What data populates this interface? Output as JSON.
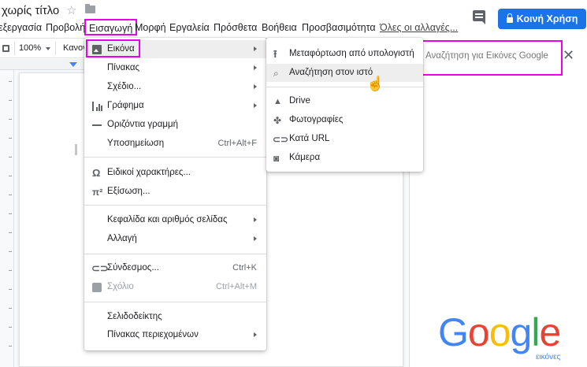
{
  "header": {
    "doc_title": "χωρίς τίτλο",
    "share_label": "Κοινή Χρήση"
  },
  "menubar": {
    "items": [
      "εξεργασία",
      "Προβολή",
      "Εισαγωγή",
      "Μορφή",
      "Εργαλεία",
      "Πρόσθετα",
      "Βοήθεια",
      "Προσβασιμότητα"
    ],
    "all_changes": "Όλες οι αλλαγές..."
  },
  "toolbar": {
    "zoom": "100%",
    "style": "Κανον"
  },
  "insert_menu": {
    "items": [
      {
        "label": "Εικόνα",
        "icon": "image-icon",
        "submenu": true
      },
      {
        "label": "Πίνακας",
        "submenu": true
      },
      {
        "label": "Σχέδιο...",
        "submenu": true
      },
      {
        "label": "Γράφημα",
        "icon": "chart-icon",
        "submenu": true
      },
      {
        "label": "Οριζόντια γραμμή",
        "icon": "horizontal-line-icon"
      },
      {
        "label": "Υποσημείωση",
        "shortcut": "Ctrl+Alt+F"
      },
      {
        "label": "Ειδικοί χαρακτήρες...",
        "icon": "omega-icon"
      },
      {
        "label": "Εξίσωση...",
        "icon": "pi-icon"
      },
      {
        "label": "Κεφαλίδα και αριθμός σελίδας",
        "submenu": true
      },
      {
        "label": "Αλλαγή",
        "submenu": true
      },
      {
        "label": "Σύνδεσμος...",
        "icon": "link-icon",
        "shortcut": "Ctrl+K"
      },
      {
        "label": "Σχόλιο",
        "icon": "comment-icon",
        "shortcut": "Ctrl+Alt+M",
        "disabled": true
      },
      {
        "label": "Σελιδοδείκτης"
      },
      {
        "label": "Πίνακας περιεχομένων",
        "submenu": true
      }
    ]
  },
  "image_submenu": {
    "items": [
      {
        "label": "Μεταφόρτωση από υπολογιστή",
        "icon": "upload-icon"
      },
      {
        "label": "Αναζήτηση στον ιστό",
        "icon": "search-icon"
      },
      {
        "label": "Drive",
        "icon": "drive-icon"
      },
      {
        "label": "Φωτογραφίες",
        "icon": "photos-icon"
      },
      {
        "label": "Κατά URL",
        "icon": "link-icon"
      },
      {
        "label": "Κάμερα",
        "icon": "camera-icon"
      }
    ]
  },
  "side_panel": {
    "search_placeholder": "Αναζήτηση για Εικόνες Google",
    "logo": [
      "G",
      "o",
      "o",
      "g",
      "l",
      "e"
    ],
    "logo_sub": "εικόνες"
  },
  "colors": {
    "accent": "#1a73e8",
    "highlight": "#ea00ea",
    "google_blue": "#4285f4",
    "google_red": "#ea4335",
    "google_yellow": "#fbbc05",
    "google_green": "#34a853"
  }
}
